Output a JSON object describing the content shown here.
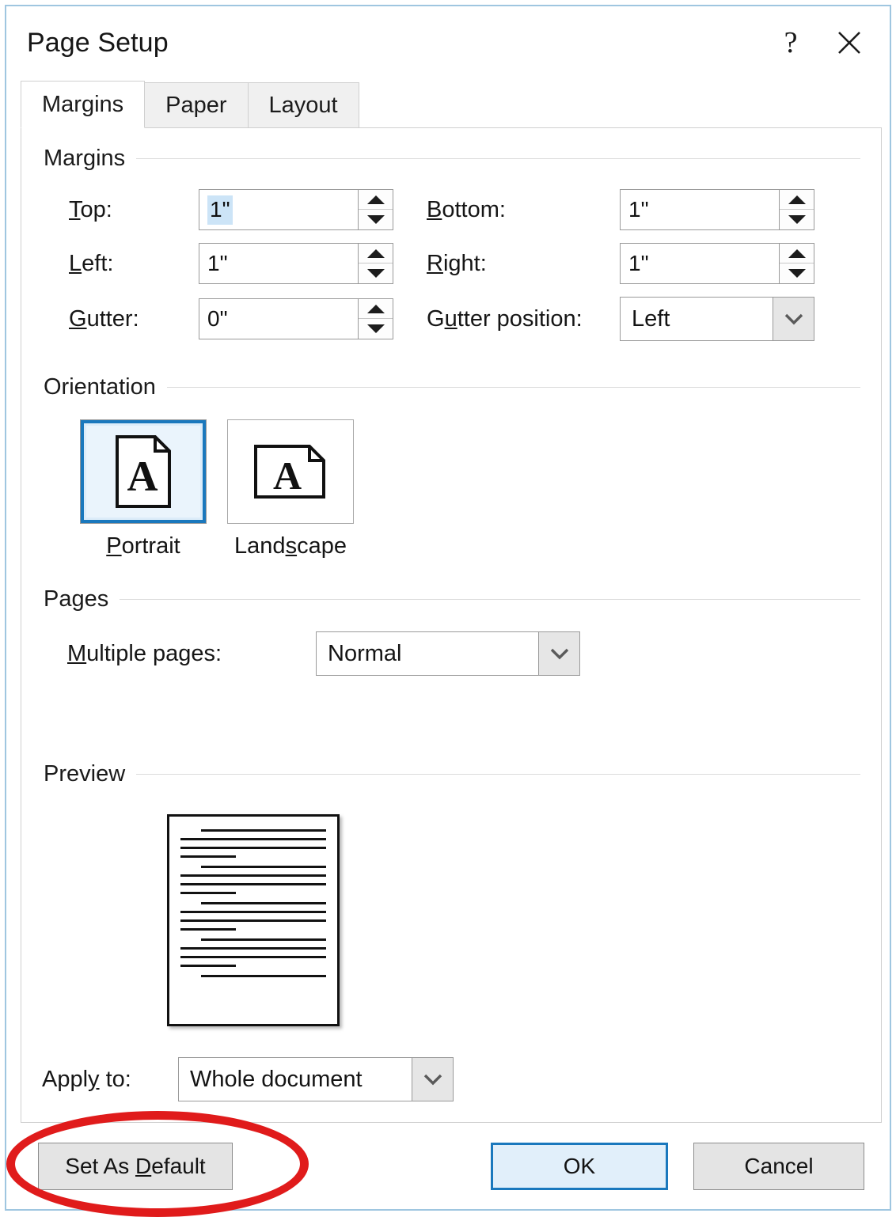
{
  "window": {
    "title": "Page Setup",
    "help_icon": "question-mark-icon",
    "close_icon": "close-x-icon"
  },
  "tabs": [
    {
      "label": "Margins",
      "active": true
    },
    {
      "label": "Paper",
      "active": false
    },
    {
      "label": "Layout",
      "active": false
    }
  ],
  "sections": {
    "margins": {
      "heading": "Margins",
      "fields": [
        {
          "label_pre": "T",
          "label_acc": "o",
          "label_post": "p:",
          "value": "1\"",
          "selected": true
        },
        {
          "label_pre": "",
          "label_acc": "B",
          "label_post": "ottom:",
          "value": "1\"",
          "selected": false
        },
        {
          "label_pre": "",
          "label_acc": "L",
          "label_post": "eft:",
          "value": "1\"",
          "selected": false
        },
        {
          "label_pre": "",
          "label_acc": "R",
          "label_post": "ight:",
          "value": "1\"",
          "selected": false
        },
        {
          "label_pre": "",
          "label_acc": "G",
          "label_post": "utter:",
          "value": "0\"",
          "selected": false
        }
      ],
      "gutter_position": {
        "label_pre": "G",
        "label_acc": "u",
        "label_post": "tter position:",
        "value": "Left",
        "arrow_icon": "chevron-down-icon"
      }
    },
    "orientation": {
      "heading": "Orientation",
      "options": [
        {
          "caption_pre": "",
          "caption_acc": "P",
          "caption_post": "ortrait",
          "selected": true,
          "icon": "portrait-page-icon"
        },
        {
          "caption_pre": "Land",
          "caption_acc": "s",
          "caption_post": "cape",
          "selected": false,
          "icon": "landscape-page-icon"
        }
      ]
    },
    "pages": {
      "heading": "Pages",
      "multiple_pages": {
        "label_pre": "",
        "label_acc": "M",
        "label_post": "ultiple pages:",
        "value": "Normal",
        "arrow_icon": "chevron-down-icon"
      }
    },
    "preview": {
      "heading": "Preview",
      "apply_to": {
        "label_pre": "Appl",
        "label_acc": "y",
        "label_post": " to:",
        "value": "Whole document",
        "arrow_icon": "chevron-down-icon"
      }
    }
  },
  "buttons": {
    "set_as_default": {
      "pre": "Set As ",
      "acc": "D",
      "post": "efault"
    },
    "ok": "OK",
    "cancel": "Cancel"
  },
  "annotation": {
    "shape": "ellipse",
    "color": "#e01b1b",
    "target": "Set As Default"
  }
}
